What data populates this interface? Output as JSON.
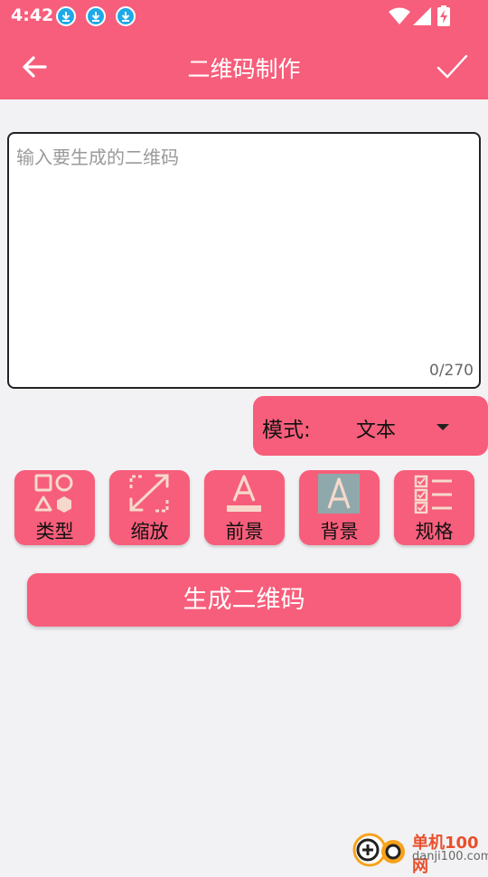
{
  "status_bar": {
    "time": "4:42",
    "icons": [
      "download-icon",
      "download-icon",
      "download-icon",
      "wifi-icon",
      "signal-icon",
      "battery-charging-icon"
    ]
  },
  "app_bar": {
    "title": "二维码制作",
    "back_icon": "arrow-left-icon",
    "confirm_icon": "check-icon"
  },
  "input": {
    "placeholder": "输入要生成的二维码",
    "value": "",
    "counter": "0/270"
  },
  "mode": {
    "label": "模式:",
    "value": "文本"
  },
  "tools": [
    {
      "label": "类型",
      "icon": "shapes-icon"
    },
    {
      "label": "缩放",
      "icon": "expand-icon"
    },
    {
      "label": "前景",
      "icon": "text-color-icon"
    },
    {
      "label": "背景",
      "icon": "background-color-icon"
    },
    {
      "label": "规格",
      "icon": "checklist-icon"
    }
  ],
  "generate_button": "生成二维码",
  "watermark": {
    "line1": "单机100网",
    "line2": "danji100.com"
  },
  "colors": {
    "accent": "#f75e7b",
    "icon_tint": "#f6d9cb",
    "background_swatch": "#8fa8ab",
    "page_background": "#f2f2f4"
  }
}
